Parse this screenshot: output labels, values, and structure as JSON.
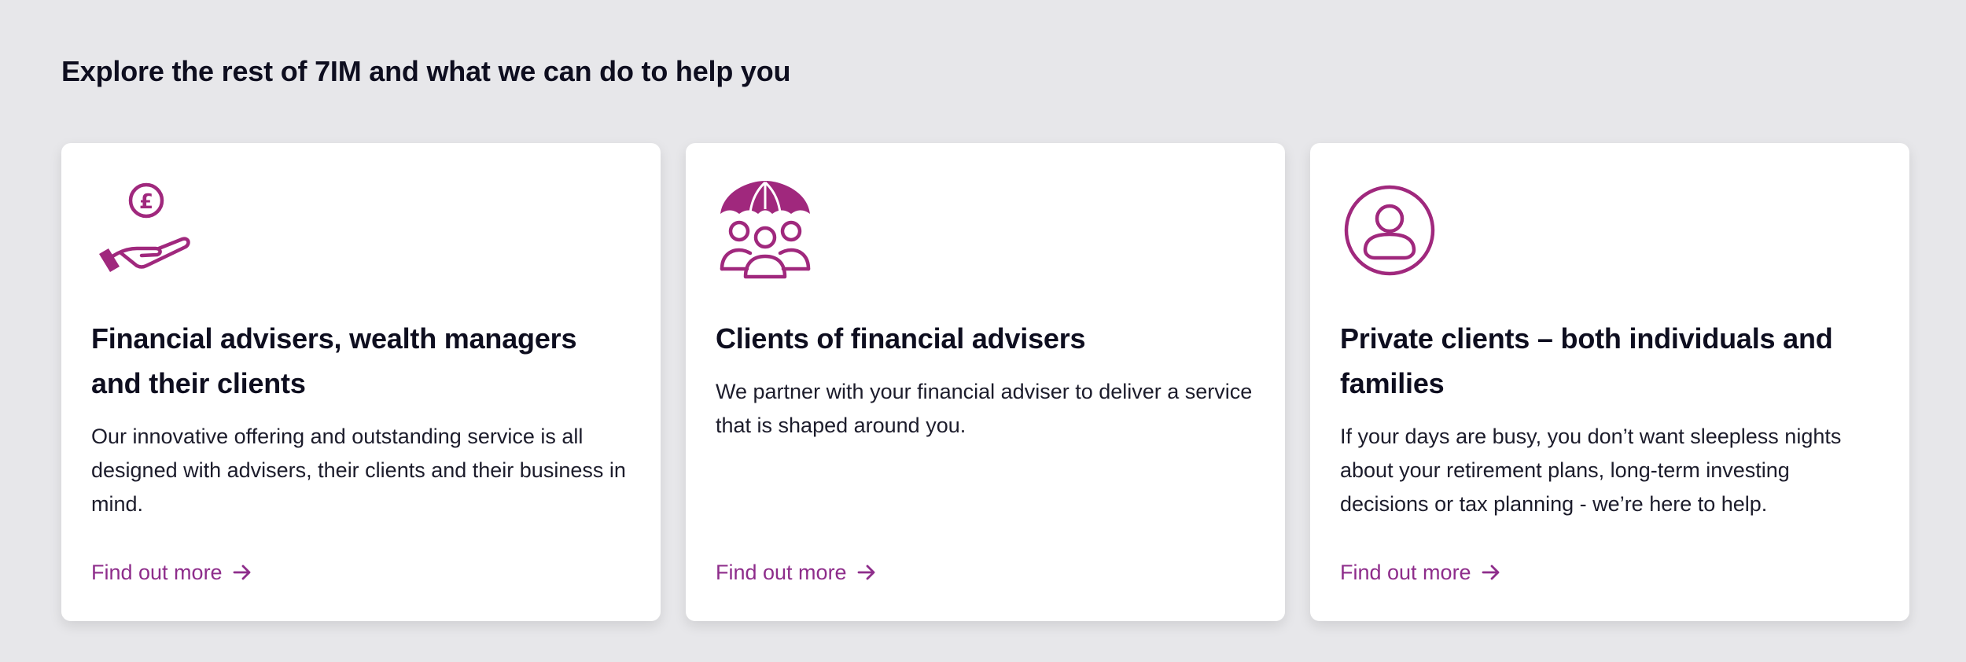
{
  "section": {
    "title": "Explore the rest of 7IM and what we can do to help you"
  },
  "accent_color": "#A0287D",
  "cards": [
    {
      "icon": "hand-pound-coin-icon",
      "title": "Financial advisers, wealth managers and their clients",
      "body": "Our innovative offering and outstanding service is all designed with advisers, their clients and their business in mind.",
      "link_label": "Find out more"
    },
    {
      "icon": "umbrella-group-icon",
      "title": "Clients of financial advisers",
      "body": "We partner with your financial adviser to deliver a service that is shaped around you.",
      "link_label": "Find out more"
    },
    {
      "icon": "person-circle-icon",
      "title": "Private clients – both individuals and families",
      "body": "If your days are busy, you don’t want sleepless nights about your retirement plans, long-term investing decisions or tax planning - we’re here to help.",
      "link_label": "Find out more"
    }
  ]
}
